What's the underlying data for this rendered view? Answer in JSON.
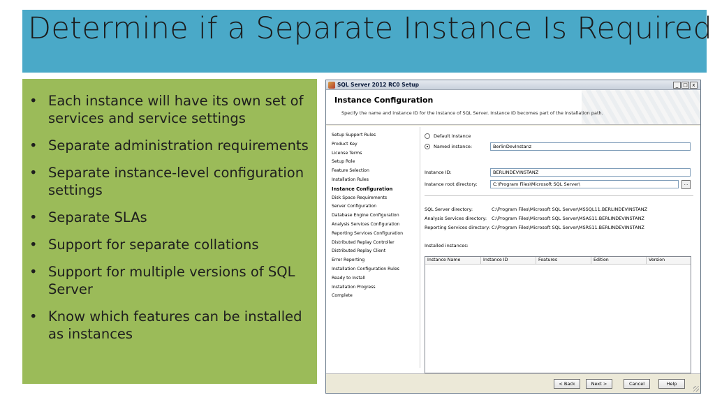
{
  "slide": {
    "title": "Determine if a Separate Instance Is Required",
    "bullets": [
      "Each instance will have its own set of services and service settings",
      "Separate administration requirements",
      "Separate instance-level configuration settings",
      "Separate SLAs",
      "Support for separate collations",
      "Support for multiple versions of SQL Server",
      "Know which features can be installed as instances"
    ],
    "bullet_glyph": "•",
    "colors": {
      "title_band": "#4aa9c8",
      "bullet_panel": "#9bbb59"
    }
  },
  "dialog": {
    "window_title": "SQL Server 2012 RC0 Setup",
    "window_buttons": [
      "_",
      "□",
      "x"
    ],
    "header_title": "Instance Configuration",
    "header_description": "Specify the name and instance ID for the instance of SQL Server. Instance ID becomes part of the installation path.",
    "nav_items": [
      "Setup Support Rules",
      "Product Key",
      "License Terms",
      "Setup Role",
      "Feature Selection",
      "Installation Rules",
      "Instance Configuration",
      "Disk Space Requirements",
      "Server Configuration",
      "Database Engine Configuration",
      "Analysis Services Configuration",
      "Reporting Services Configuration",
      "Distributed Replay Controller",
      "Distributed Replay Client",
      "Error Reporting",
      "Installation Configuration Rules",
      "Ready to Install",
      "Installation Progress",
      "Complete"
    ],
    "active_nav": "Instance Configuration",
    "default_instance_label": "Default instance",
    "named_instance_label": "Named instance:",
    "named_instance_value": "BerlinDevInstanz",
    "instance_id_label": "Instance ID:",
    "instance_id_value": "BERLINDEVINSTANZ",
    "instance_root_label": "Instance root directory:",
    "instance_root_value": "C:\\Program Files\\Microsoft SQL Server\\",
    "browse_label": "...",
    "sql_dir_label": "SQL Server directory:",
    "sql_dir_value": "C:\\Program Files\\Microsoft SQL Server\\MSSQL11.BERLINDEVINSTANZ",
    "as_dir_label": "Analysis Services directory:",
    "as_dir_value": "C:\\Program Files\\Microsoft SQL Server\\MSAS11.BERLINDEVINSTANZ",
    "rs_dir_label": "Reporting Services directory:",
    "rs_dir_value": "C:\\Program Files\\Microsoft SQL Server\\MSRS11.BERLINDEVINSTANZ",
    "installed_instances_label": "Installed instances:",
    "table_columns": [
      "Instance Name",
      "Instance ID",
      "Features",
      "Edition",
      "Version"
    ],
    "buttons": {
      "back": "< Back",
      "next": "Next >",
      "cancel": "Cancel",
      "help": "Help"
    }
  }
}
